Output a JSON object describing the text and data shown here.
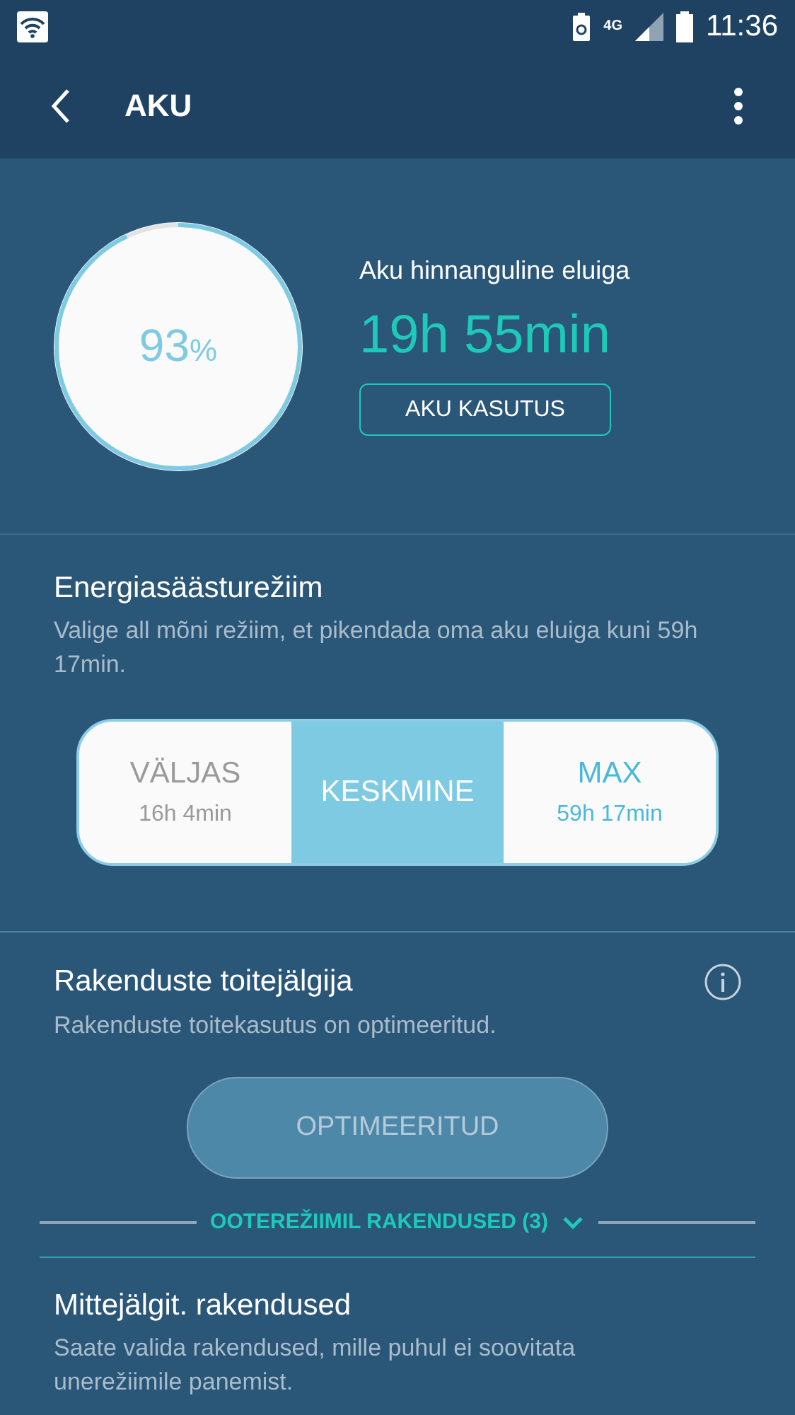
{
  "status_bar": {
    "time": "11:36",
    "network": "4G"
  },
  "app_bar": {
    "title": "AKU"
  },
  "battery": {
    "percent": "93",
    "unit": "%",
    "level": 0.93,
    "estimate_label": "Aku hinnanguline eluiga",
    "estimate": "19h 55min",
    "usage_button": "AKU KASUTUS"
  },
  "power_saving": {
    "title": "Energiasäästurežiim",
    "description": "Valige all mõni režiim, et pikendada oma aku eluiga kuni 59h 17min.",
    "modes": [
      {
        "label": "VÄLJAS",
        "time": "16h 4min",
        "selected": false,
        "accent": false
      },
      {
        "label": "KESKMINE",
        "selected": true,
        "accent": false
      },
      {
        "label": "MAX",
        "time": "59h 17min",
        "selected": false,
        "accent": true
      }
    ]
  },
  "app_monitor": {
    "title": "Rakenduste toitejälgija",
    "description": "Rakenduste toitekasutus on optimeeritud.",
    "button": {
      "label": "OPTIMEERITUD",
      "disabled": true
    },
    "standby_apps": {
      "label": "OOTEREŽIIMIL RAKENDUSED (3)",
      "expanded": false
    }
  },
  "unmonitored": {
    "title": "Mittejälgit. rakendused",
    "description": "Saate valida rakendused, mille puhul ei soovitata unerežiimile panemist."
  }
}
